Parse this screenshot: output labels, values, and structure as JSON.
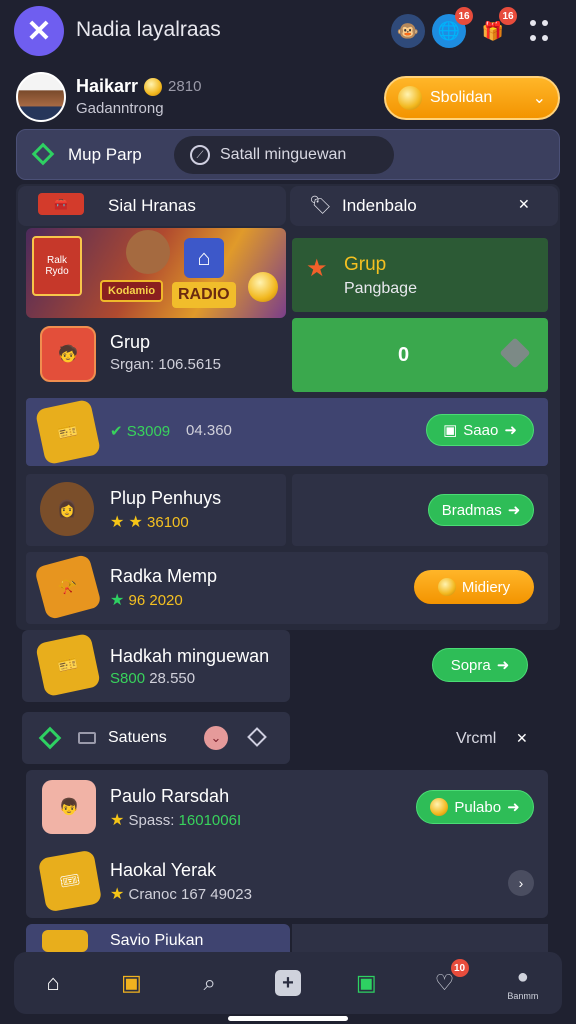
{
  "header": {
    "title": "Nadia layalraas",
    "icons": [
      {
        "name": "character-icon",
        "badge": ""
      },
      {
        "name": "globe-icon",
        "badge": "16"
      },
      {
        "name": "gift-chest-icon",
        "badge": "16"
      }
    ]
  },
  "profile": {
    "name": "Haikarr",
    "level": "2810",
    "subtitle": "Gadanntrong",
    "action_label": "Sbolidan"
  },
  "search": {
    "section_label": "Mup Parp",
    "placeholder": "Satall minguewan"
  },
  "tabs": {
    "left_label": "Sial Hranas",
    "right_label": "Indenbalo"
  },
  "banner": {
    "tag_top": "Ralk",
    "tag_bottom": "Rydo",
    "sign_left": "Kodamio",
    "sign_right": "RADIO"
  },
  "promo_card": {
    "title": "Grup",
    "subtitle": "Pangbage"
  },
  "counter_card": {
    "value": "0"
  },
  "rows": [
    {
      "title": "Grup",
      "meta": "Srgan: 106.5615"
    },
    {
      "title": "",
      "meta_prefix": "S3009",
      "meta": "04.360",
      "button": "Saao"
    },
    {
      "title": "Plup Penhuys",
      "meta": "36100",
      "button": "Bradmas"
    },
    {
      "title": "Radka Memp",
      "meta": "96 2020",
      "button": "Midiery"
    },
    {
      "title": "Hadkah minguewan",
      "meta_prefix": "S800",
      "meta": "28.550",
      "button": "Sopra"
    }
  ],
  "section2": {
    "label": "Satuens",
    "right_label": "Vrcml"
  },
  "list2": [
    {
      "title": "Paulo Rarsdah",
      "meta_label": "Spass:",
      "meta": "1601006I",
      "button": "Pulabo"
    },
    {
      "title": "Haokal Yerak",
      "meta_label": "Cranoc",
      "meta": "167 49023",
      "button": ""
    },
    {
      "title": "Savio Piukan",
      "meta_label": "",
      "meta": "",
      "button": ""
    }
  ],
  "navbar": {
    "items": [
      "home-icon",
      "shop-icon",
      "search-icon",
      "add-icon",
      "bag-icon",
      "heart-icon",
      "profile-icon"
    ],
    "heart_badge": "10",
    "profile_label": "Banmm"
  },
  "colors": {
    "background": "#1f2130",
    "accent_green": "#2ebd57",
    "accent_orange": "#f39400",
    "accent_purple": "#6f5ef0"
  }
}
